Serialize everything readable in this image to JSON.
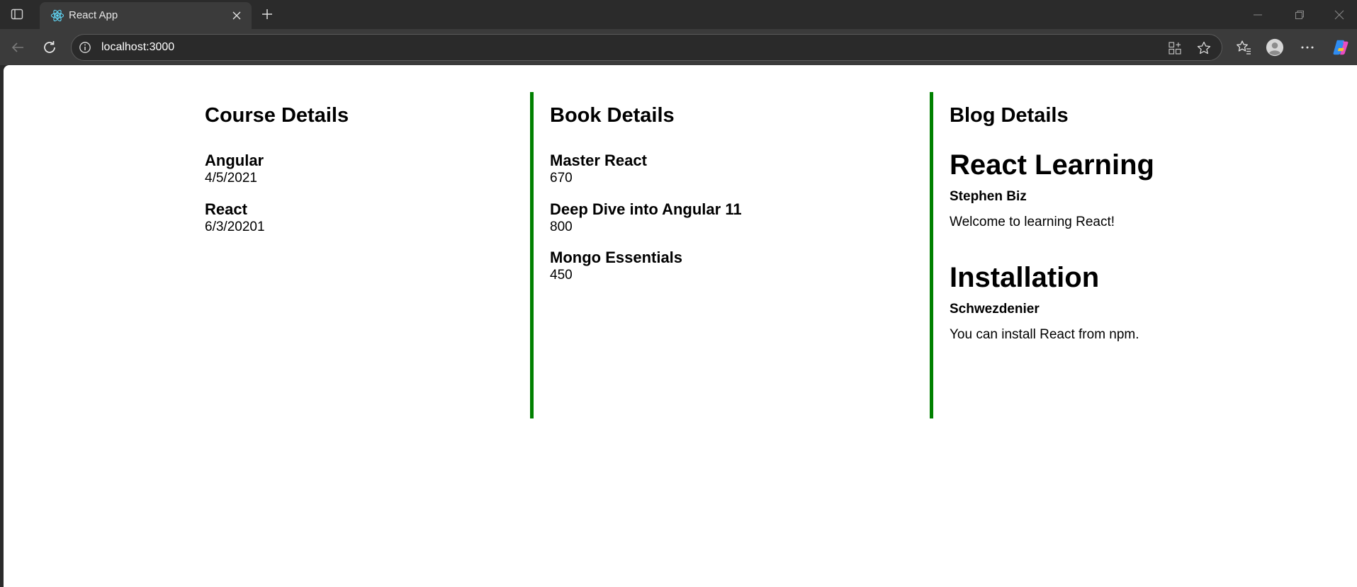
{
  "browser": {
    "tab_title": "React App",
    "url": "localhost:3000",
    "icons": {
      "sidebar": "sidebar-toggle-icon",
      "favicon": "react-logo-icon",
      "close": "close-icon",
      "new_tab": "plus-icon",
      "back": "arrow-left-icon",
      "reload": "reload-icon",
      "site_info": "info-icon",
      "app_available": "grid-plus-icon",
      "favorite": "star-icon",
      "favorites": "favorites-icon",
      "profile": "profile-icon",
      "more": "ellipsis-icon",
      "copilot": "copilot-icon"
    }
  },
  "courses": {
    "heading": "Course Details",
    "items": [
      {
        "name": "Angular",
        "date": "4/5/2021"
      },
      {
        "name": "React",
        "date": "6/3/20201"
      }
    ]
  },
  "books": {
    "heading": "Book Details",
    "items": [
      {
        "name": "Master React",
        "price": "670"
      },
      {
        "name": "Deep Dive into Angular 11",
        "price": "800"
      },
      {
        "name": "Mongo Essentials",
        "price": "450"
      }
    ]
  },
  "blogs": {
    "heading": "Blog Details",
    "items": [
      {
        "title": "React Learning",
        "author": "Stephen Biz",
        "content": "Welcome to learning React!"
      },
      {
        "title": "Installation",
        "author": "Schwezdenier",
        "content": "You can install React from npm."
      }
    ]
  },
  "colors": {
    "divider": "#008000",
    "chrome_dark": "#2b2b2b",
    "chrome_toolbar": "#3b3b3b"
  }
}
